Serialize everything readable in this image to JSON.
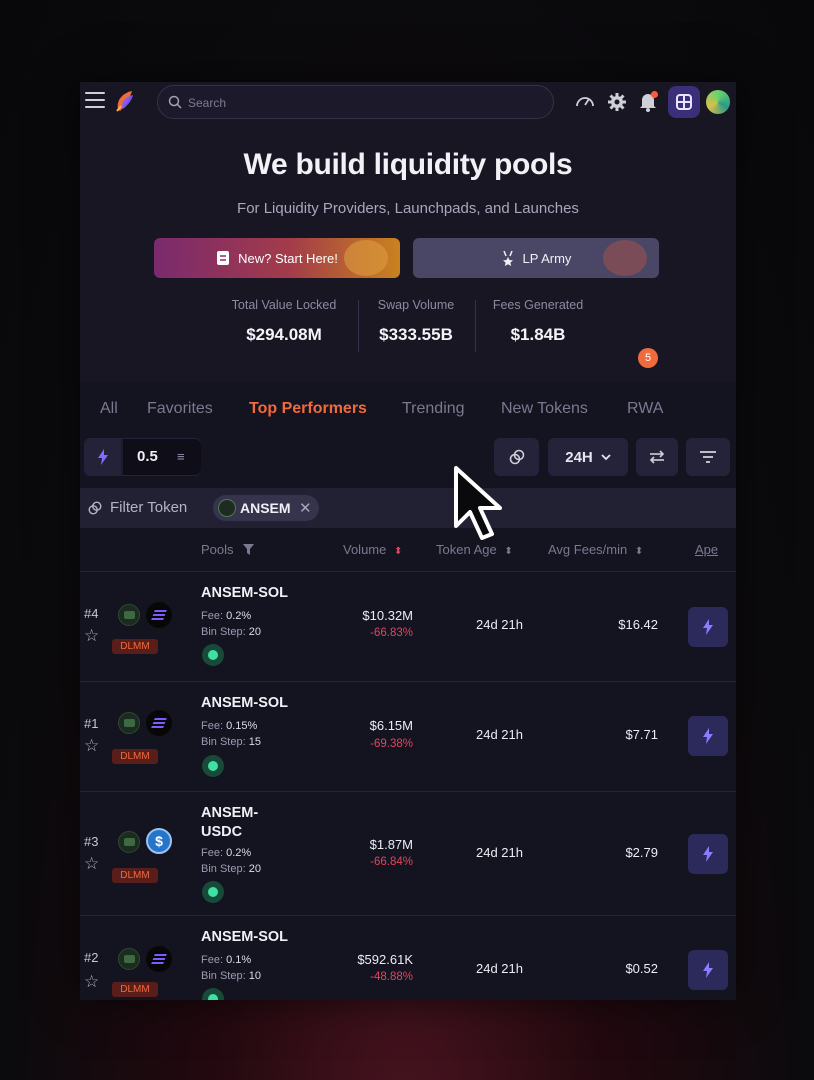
{
  "nav": {
    "search_placeholder": "Search"
  },
  "hero": {
    "title": "We build liquidity pools",
    "subtitle": "For Liquidity Providers, Launchpads, and Launches",
    "cta_primary": "New? Start Here!",
    "cta_secondary": "LP Army"
  },
  "stats": [
    {
      "label": "Total Value Locked",
      "value": "$294.08M"
    },
    {
      "label": "Swap Volume",
      "value": "$333.55B"
    },
    {
      "label": "Fees Generated",
      "value": "$1.84B"
    }
  ],
  "tabs": [
    "All",
    "Favorites",
    "Top Performers",
    "Trending",
    "New Tokens",
    "RWA"
  ],
  "active_tab": "Top Performers",
  "controls": {
    "ape_amount": "0.5",
    "ape_unit": "≡",
    "timeframe": "24H",
    "filter_count": "5"
  },
  "filter": {
    "label": "Filter Token",
    "chip": "ANSEM",
    "chip_remove": "✕"
  },
  "table": {
    "headers": {
      "pools": "Pools",
      "volume": "Volume",
      "token_age": "Token Age",
      "avg_fees": "Avg Fees/min",
      "ape": "Ape"
    },
    "rows": [
      {
        "rank": "#4",
        "name": "ANSEM-SOL",
        "fee_label": "Fee:",
        "fee": "0.2%",
        "bin_label": "Bin Step:",
        "bin": "20",
        "volume": "$10.32M",
        "change": "-66.83%",
        "age": "24d 21h",
        "fees": "$16.42",
        "badge": "DLMM",
        "quote": "SOL"
      },
      {
        "rank": "#1",
        "name": "ANSEM-SOL",
        "fee_label": "Fee:",
        "fee": "0.15%",
        "bin_label": "Bin Step:",
        "bin": "15",
        "volume": "$6.15M",
        "change": "-69.38%",
        "age": "24d 21h",
        "fees": "$7.71",
        "badge": "DLMM",
        "quote": "SOL"
      },
      {
        "rank": "#3",
        "name_line1": "ANSEM-",
        "name_line2": "USDC",
        "fee_label": "Fee:",
        "fee": "0.2%",
        "bin_label": "Bin Step:",
        "bin": "20",
        "volume": "$1.87M",
        "change": "-66.84%",
        "age": "24d 21h",
        "fees": "$2.79",
        "badge": "DLMM",
        "quote": "USDC"
      },
      {
        "rank": "#2",
        "name": "ANSEM-SOL",
        "fee_label": "Fee:",
        "fee": "0.1%",
        "bin_label": "Bin Step:",
        "bin": "10",
        "volume": "$592.61K",
        "change": "-48.88%",
        "age": "24d 21h",
        "fees": "$0.52",
        "badge": "DLMM",
        "quote": "SOL"
      }
    ]
  },
  "colors": {
    "accent": "#ef6b3e",
    "negative": "#e0475a",
    "ape_button": "#2b2a5a",
    "background": "#181623"
  },
  "icons": [
    "menu-icon",
    "logo-icon",
    "search-icon",
    "speedometer-icon",
    "gear-icon",
    "bell-icon",
    "app-grid-icon",
    "globe-icon",
    "bolt-icon",
    "link-icon",
    "chevron-down-icon",
    "swap-icon",
    "filter-icon",
    "star-icon",
    "cursor-icon"
  ]
}
